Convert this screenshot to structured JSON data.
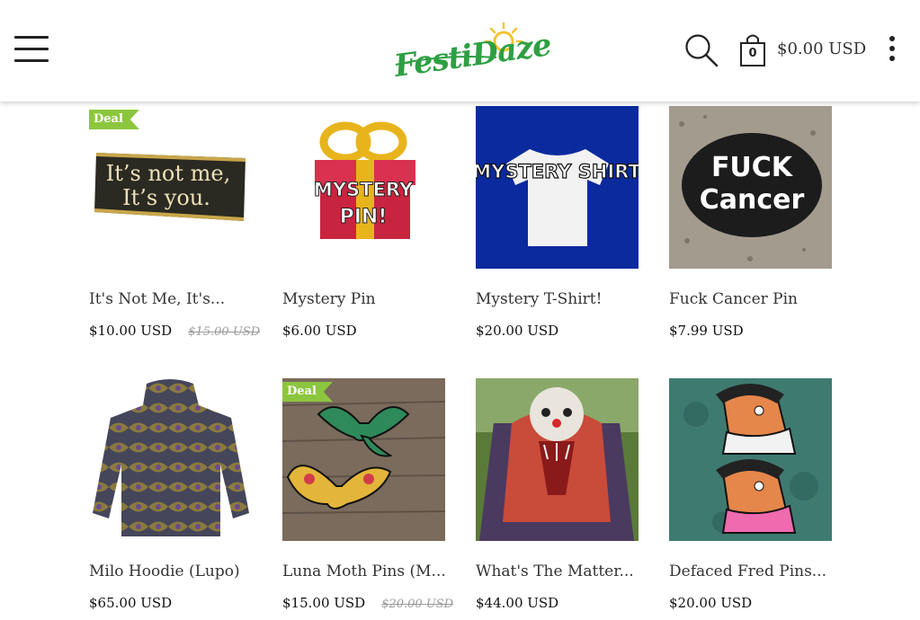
{
  "header": {
    "logo_text": "FestiDaze",
    "cart_count": "0",
    "cart_total": "$0.00 USD"
  },
  "products": [
    {
      "title": "It's Not Me, It's...",
      "price": "$10.00 USD",
      "old_price": "$15.00 USD",
      "deal": "Deal",
      "image_text_1": "It’s not me,",
      "image_text_2": "It’s you."
    },
    {
      "title": "Mystery Pin",
      "price": "$6.00 USD",
      "image_text_1": "MYSTERY",
      "image_text_2": "PIN!"
    },
    {
      "title": "Mystery T-Shirt!",
      "price": "$20.00 USD",
      "image_text_1": "MYSTERY SHIRT"
    },
    {
      "title": "Fuck Cancer Pin",
      "price": "$7.99 USD",
      "image_text_1": "FUCK",
      "image_text_2": "Cancer"
    },
    {
      "title": "Milo Hoodie (Lupo)",
      "price": "$65.00 USD"
    },
    {
      "title": "Luna Moth Pins (M...",
      "price": "$15.00 USD",
      "old_price": "$20.00 USD",
      "deal": "Deal"
    },
    {
      "title": "What's The Matter...",
      "price": "$44.00 USD"
    },
    {
      "title": "Defaced Fred Pins...",
      "price": "$20.00 USD"
    }
  ],
  "colors": {
    "deal_badge": "#8cc63f",
    "logo_green": "#2e9f43",
    "logo_sun": "#f4c430",
    "shirt_bg": "#0a2a9e"
  }
}
